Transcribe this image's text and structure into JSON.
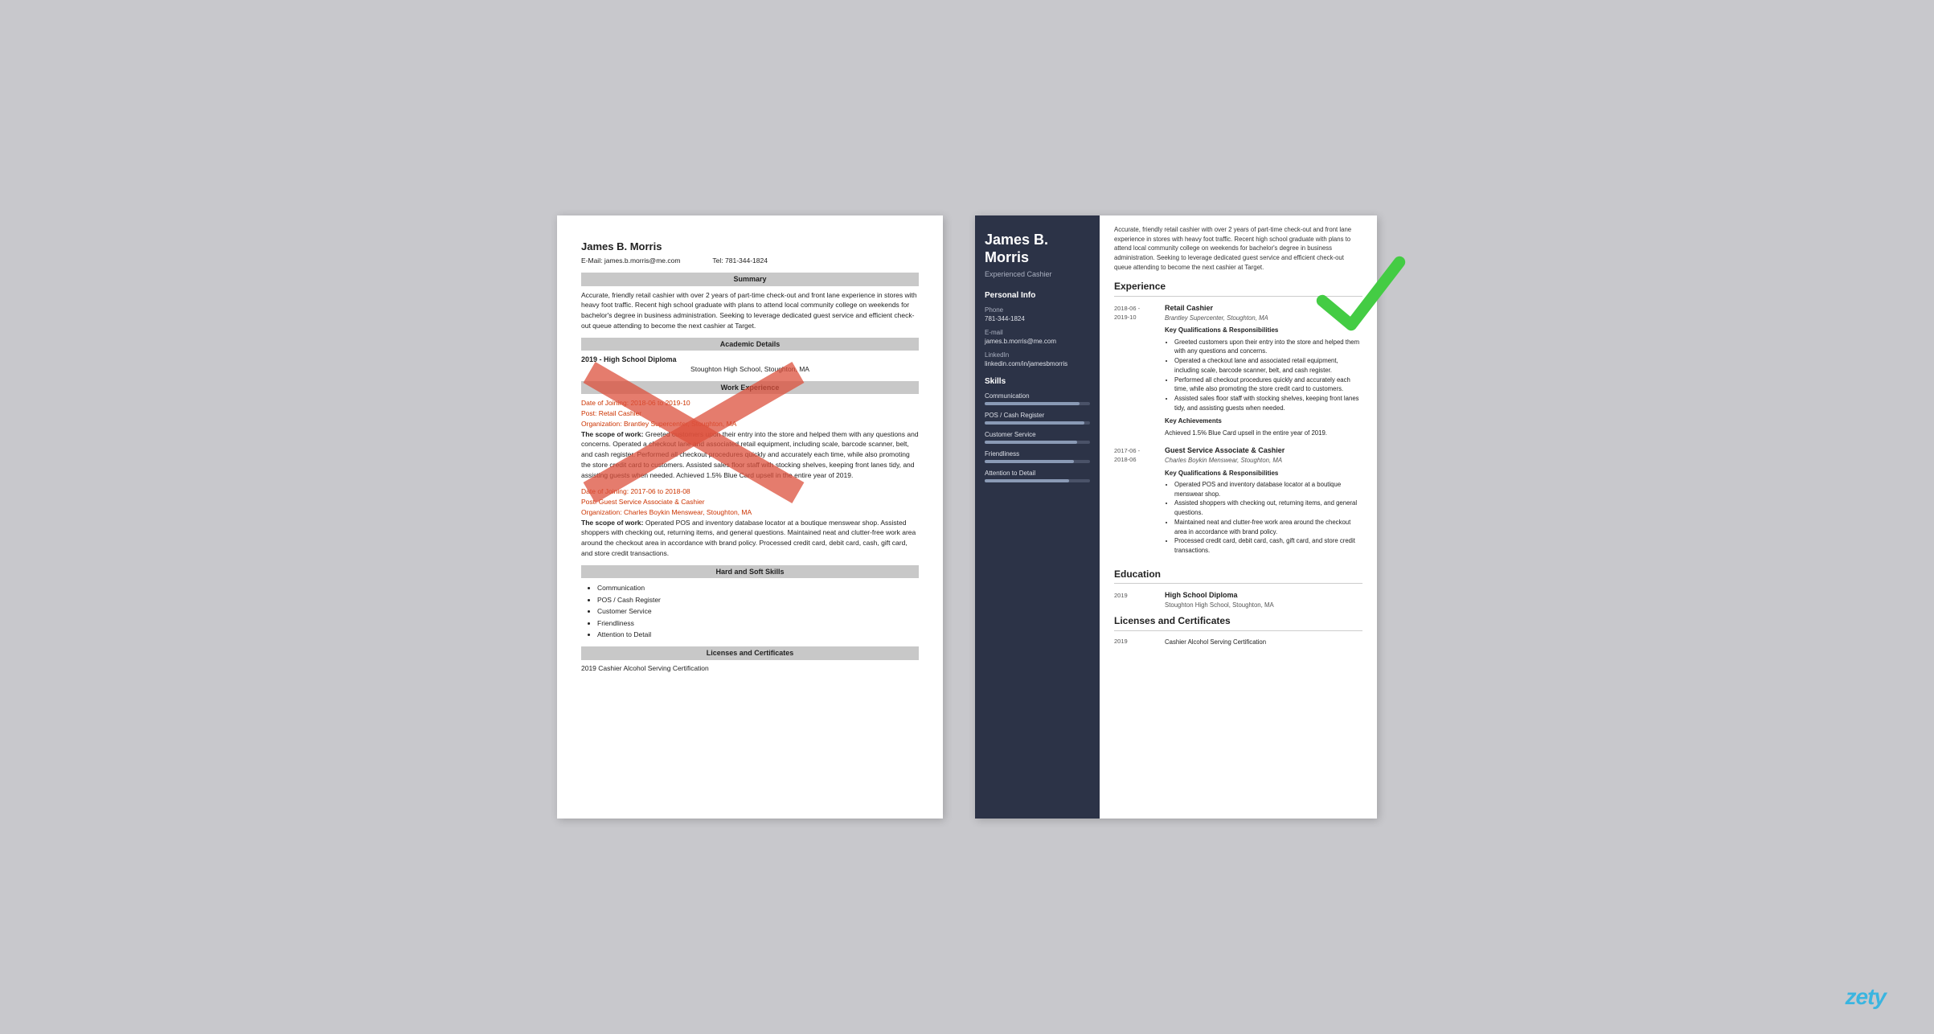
{
  "left_resume": {
    "name": "James B. Morris",
    "email_label": "E-Mail:",
    "email": "james.b.morris@me.com",
    "tel_label": "Tel:",
    "tel": "781-344-1824",
    "sections": {
      "summary": {
        "header": "Summary",
        "text": "Accurate, friendly retail cashier with over 2 years of part-time check-out and front lane experience in stores with heavy foot traffic. Recent high school graduate with plans to attend local community college on weekends for bachelor's degree in business administration. Seeking to leverage dedicated guest service and efficient check-out queue attending to become the next cashier at Target."
      },
      "academic": {
        "header": "Academic Details",
        "year": "2019 - High School Diploma",
        "school": "Stoughton High School, Stoughton, MA"
      },
      "work": {
        "header": "Work Experience",
        "job1": {
          "date_label": "Date of Joining:",
          "dates": "2018-06 to 2019-10",
          "post_label": "Post:",
          "post": "Retail Cashier",
          "org_label": "Organization:",
          "org": "Brantley Supercenter, Stoughton, MA",
          "scope_label": "The scope of work:",
          "scope": "Greeted customers upon their entry into the store and helped them with any questions and concerns. Operated a checkout lane and associated retail equipment, including scale, barcode scanner, belt, and cash register. Performed all checkout procedures quickly and accurately each time, while also promoting the store credit card to customers. Assisted sales floor staff with stocking shelves, keeping front lanes tidy, and assisting guests when needed. Achieved 1.5% Blue Card upsell in the entire year of 2019."
        },
        "job2": {
          "date_label": "Date of Joining:",
          "dates": "2017-06 to 2018-08",
          "post_label": "Post:",
          "post": "Guest Service Associate & Cashier",
          "org_label": "Organization:",
          "org": "Charles Boykin Menswear, Stoughton, MA",
          "scope_label": "The scope of work:",
          "scope": "Operated POS and inventory database locator at a boutique menswear shop. Assisted shoppers with checking out, returning items, and general questions. Maintained neat and clutter-free work area around the checkout area in accordance with brand policy. Processed credit card, debit card, cash, gift card, and store credit transactions."
        }
      },
      "skills": {
        "header": "Hard and Soft Skills",
        "items": [
          "Communication",
          "POS / Cash Register",
          "Customer Service",
          "Friendliness",
          "Attention to Detail"
        ]
      },
      "licenses": {
        "header": "Licenses and Certificates",
        "cert": "2019 Cashier Alcohol Serving Certification"
      }
    }
  },
  "right_resume": {
    "sidebar": {
      "name": "James B. Morris",
      "title": "Experienced Cashier",
      "personal_info_header": "Personal Info",
      "phone_label": "Phone",
      "phone": "781-344-1824",
      "email_label": "E-mail",
      "email": "james.b.morris@me.com",
      "linkedin_label": "LinkedIn",
      "linkedin": "linkedin.com/in/jamesbmorris",
      "skills_header": "Skills",
      "skills": [
        {
          "name": "Communication",
          "pct": 90
        },
        {
          "name": "POS / Cash Register",
          "pct": 95
        },
        {
          "name": "Customer Service",
          "pct": 88
        },
        {
          "name": "Friendliness",
          "pct": 85
        },
        {
          "name": "Attention to Detail",
          "pct": 80
        }
      ]
    },
    "main": {
      "summary": "Accurate, friendly retail cashier with over 2 years of part-time check-out and front lane experience in stores with heavy foot traffic. Recent high school graduate with plans to attend local community college on weekends for bachelor's degree in business administration. Seeking to leverage dedicated guest service and efficient check-out queue attending to become the next cashier at Target.",
      "experience_header": "Experience",
      "jobs": [
        {
          "date_start": "2018-06 -",
          "date_end": "2019-10",
          "title": "Retail Cashier",
          "company": "Brantley Supercenter, Stoughton, MA",
          "kq_label": "Key Qualifications & Responsibilities",
          "bullets": [
            "Greeted customers upon their entry into the store and helped them with any questions and concerns.",
            "Operated a checkout lane and associated retail equipment, including scale, barcode scanner, belt, and cash register.",
            "Performed all checkout procedures quickly and accurately each time, while also promoting the store credit card to customers.",
            "Assisted sales floor staff with stocking shelves, keeping front lanes tidy, and assisting guests when needed."
          ],
          "achievement_label": "Key Achievements",
          "achievement": "Achieved 1.5% Blue Card upsell in the entire year of 2019."
        },
        {
          "date_start": "2017-06 -",
          "date_end": "2018-06",
          "title": "Guest Service Associate & Cashier",
          "company": "Charles Boykin Menswear, Stoughton, MA",
          "kq_label": "Key Qualifications & Responsibilities",
          "bullets": [
            "Operated POS and inventory database locator at a boutique menswear shop.",
            "Assisted shoppers with checking out, returning items, and general questions.",
            "Maintained neat and clutter-free work area around the checkout area in accordance with brand policy.",
            "Processed credit card, debit card, cash, gift card, and store credit transactions."
          ]
        }
      ],
      "education_header": "Education",
      "education": [
        {
          "year": "2019",
          "title": "High School Diploma",
          "school": "Stoughton High School, Stoughton, MA"
        }
      ],
      "licenses_header": "Licenses and Certificates",
      "certificates": [
        {
          "year": "2019",
          "text": "Cashier Alcohol Serving Certification"
        }
      ]
    }
  },
  "watermark": "zety"
}
